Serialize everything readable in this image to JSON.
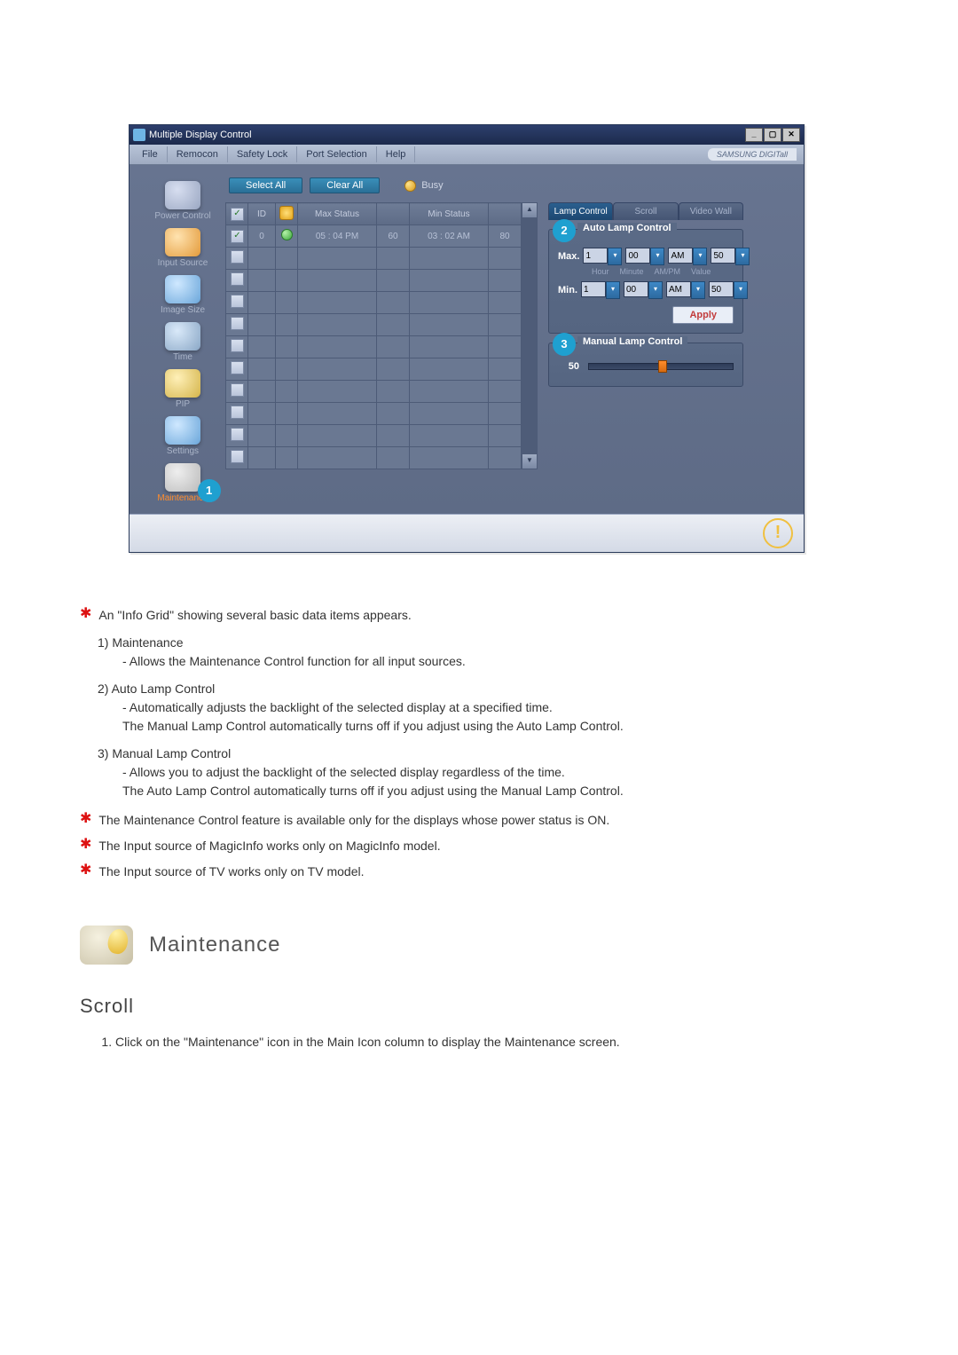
{
  "window": {
    "title": "Multiple Display Control",
    "brand": "SAMSUNG DIGITall"
  },
  "menubar": {
    "items": [
      "File",
      "Remocon",
      "Safety Lock",
      "Port Selection",
      "Help"
    ]
  },
  "sidebar": {
    "items": [
      {
        "label": "Power Control"
      },
      {
        "label": "Input Source"
      },
      {
        "label": "Image Size"
      },
      {
        "label": "Time"
      },
      {
        "label": "PIP"
      },
      {
        "label": "Settings"
      },
      {
        "label": "Maintenance",
        "active": true
      }
    ]
  },
  "toolbar": {
    "select_all": "Select All",
    "clear_all": "Clear All",
    "busy": "Busy"
  },
  "grid": {
    "headers": {
      "id": "ID",
      "max_status": "Max Status",
      "min_status": "Min Status"
    },
    "row": {
      "id": "0",
      "max_time": "05 : 04 PM",
      "max_val": "60",
      "min_time": "03 : 02 AM",
      "min_val": "80"
    }
  },
  "tabs": {
    "lamp": "Lamp Control",
    "scroll": "Scroll",
    "video_wall": "Video Wall"
  },
  "auto_lamp": {
    "title": "Auto Lamp Control",
    "max_label": "Max.",
    "min_label": "Min.",
    "hour_hdr": "Hour",
    "minute_hdr": "Minute",
    "ampm_hdr": "AM/PM",
    "value_hdr": "Value",
    "max": {
      "hour": "1",
      "minute": "00",
      "ampm": "AM",
      "value": "50"
    },
    "min": {
      "hour": "1",
      "minute": "00",
      "ampm": "AM",
      "value": "50"
    },
    "apply": "Apply"
  },
  "manual_lamp": {
    "title": "Manual Lamp Control",
    "value": "50"
  },
  "callouts": {
    "one": "1",
    "two": "2",
    "three": "3"
  },
  "doc": {
    "star1": "An \"Info Grid\" showing several basic data items appears.",
    "n1_title": "1)  Maintenance",
    "n1_dash": "- Allows the Maintenance Control function for all input sources.",
    "n2_title": "2)  Auto Lamp Control",
    "n2_dash_a": "- Automatically adjusts the backlight of the selected display at a specified time.",
    "n2_dash_b": "The Manual Lamp Control automatically turns off if you adjust using the Auto Lamp Control.",
    "n3_title": "3)  Manual Lamp Control",
    "n3_dash_a": "- Allows you to adjust the backlight of the selected display regardless of the time.",
    "n3_dash_b": "The Auto Lamp Control automatically turns off if you adjust using the Manual Lamp Control.",
    "star2": "The Maintenance Control feature is available only for the displays whose power status is ON.",
    "star3": "The Input source of MagicInfo works only on MagicInfo model.",
    "star4": "The Input source of TV works only on TV model.",
    "section": "Maintenance",
    "sub": "Scroll",
    "step1": "Click on the \"Maintenance\" icon in the Main Icon column to display the Maintenance screen."
  }
}
